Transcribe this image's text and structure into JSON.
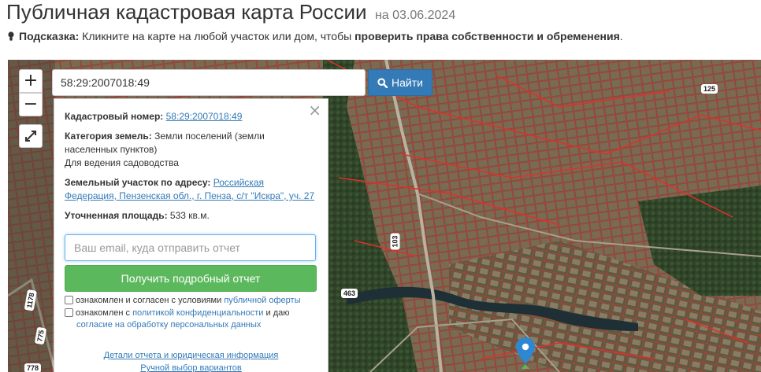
{
  "header": {
    "title": "Публичная кадастровая карта России",
    "date": "на 03.06.2024"
  },
  "hint": {
    "label": "Подсказка:",
    "text": " Кликните на карте на любой участок или дом, чтобы ",
    "bold": "проверить права собственности и обременения",
    "end": "."
  },
  "map": {
    "zoom_in": "+",
    "zoom_out": "−",
    "search_value": "58:29:2007018:49",
    "search_button": "Найти",
    "route_labels": [
      "125",
      "103",
      "463",
      "1178",
      "775",
      "778"
    ]
  },
  "panel": {
    "close": "×",
    "cadastral_label": "Кадастровый номер:",
    "cadastral_value": "58:29:2007018:49",
    "category_label": "Категория земель:",
    "category_value_1": " Земли поселений (земли",
    "category_value_2": "населенных пунктов)",
    "category_value_3": "Для ведения садоводства",
    "address_label": "Земельный участок по адресу:",
    "address_value_1": "Российская",
    "address_value_2": "Федерация, Пензенская обл., г. Пенза, с/т \"Искра\", уч. 27",
    "area_label": "Уточненная площадь:",
    "area_value": " 533 кв.м.",
    "email_placeholder": "Ваш email, куда отправить отчет",
    "report_button": "Получить подробный отчет",
    "consent1_text": "ознакомлен и согласен с условиями ",
    "consent1_link": "публичной оферты",
    "consent2_text": "ознакомлен с ",
    "consent2_link": "политикой конфиденциальности",
    "consent2_mid": " и даю",
    "consent2_link2": "согласие на обработку персональных данных",
    "details_link": "Детали отчета и юридическая информация",
    "manual_link": "Ручной выбор вариантов"
  },
  "colors": {
    "primary": "#337ab7",
    "success": "#5cb85c",
    "parcel": "#e0302a"
  }
}
